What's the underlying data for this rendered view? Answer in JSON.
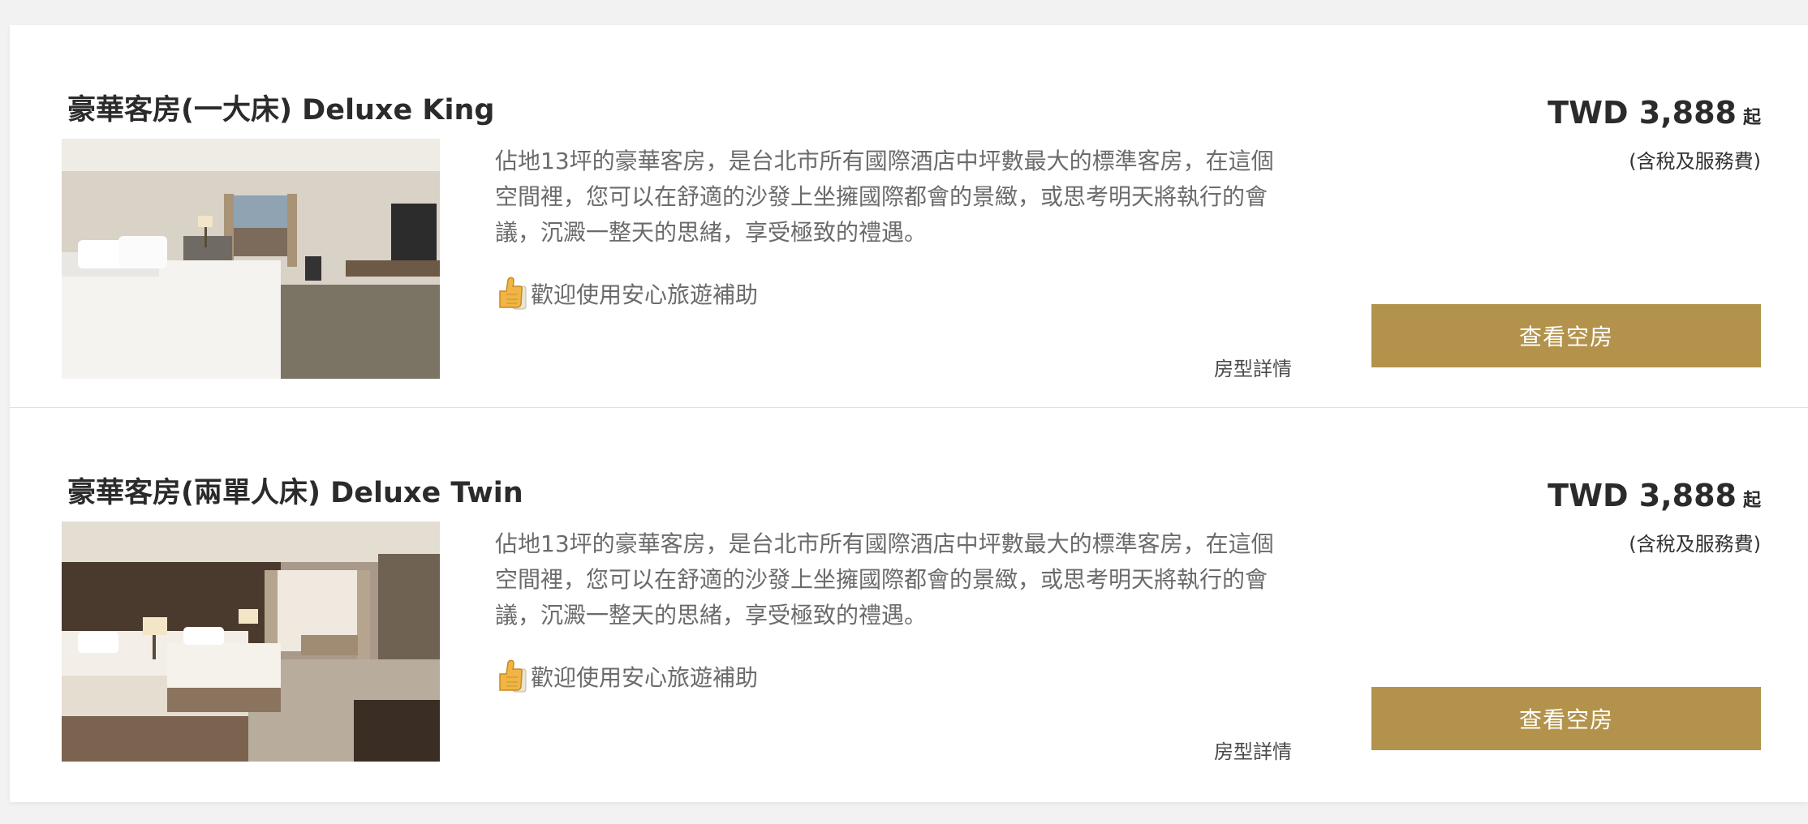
{
  "rooms": [
    {
      "title": "豪華客房(一大床) Deluxe King",
      "photo_alt": "豪華客房(一大床) Deluxe King",
      "description": "佔地13坪的豪華客房，是台北市所有國際酒店中坪數最大的標準客房，在這個空間裡，您可以在舒適的沙發上坐擁國際都會的景緻，或思考明天將執行的會議，沉澱一整天的思緒，享受極致的禮遇。",
      "promo": "歡迎使用安心旅遊補助",
      "promo_icon": "thumbs-up-icon",
      "details_link": "房型詳情",
      "price": "TWD 3,888",
      "price_suffix": "起",
      "price_note": "(含稅及服務費)",
      "button": "查看空房"
    },
    {
      "title": "豪華客房(兩單人床) Deluxe Twin",
      "photo_alt": "豪華客房(兩單人床) Deluxe Twin",
      "description": "佔地13坪的豪華客房，是台北市所有國際酒店中坪數最大的標準客房，在這個空間裡，您可以在舒適的沙發上坐擁國際都會的景緻，或思考明天將執行的會議，沉澱一整天的思緒，享受極致的禮遇。",
      "promo": "歡迎使用安心旅遊補助",
      "promo_icon": "thumbs-up-icon",
      "details_link": "房型詳情",
      "price": "TWD 3,888",
      "price_suffix": "起",
      "price_note": "(含稅及服務費)",
      "button": "查看空房"
    }
  ],
  "colors": {
    "button_bg": "#b3934c",
    "button_text": "#ffffff",
    "page_bg": "#f2f2f2",
    "card_bg": "#ffffff"
  }
}
